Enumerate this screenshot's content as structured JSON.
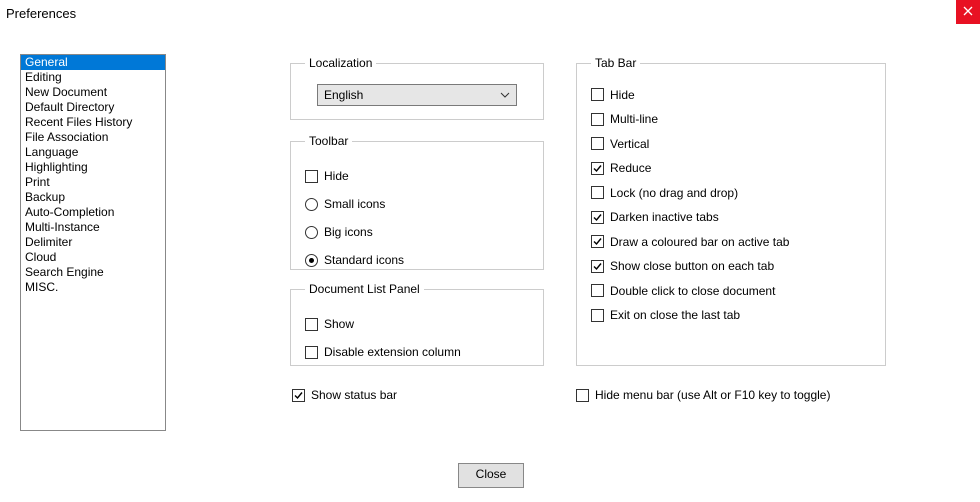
{
  "title": "Preferences",
  "categories": [
    "General",
    "Editing",
    "New Document",
    "Default Directory",
    "Recent Files History",
    "File Association",
    "Language",
    "Highlighting",
    "Print",
    "Backup",
    "Auto-Completion",
    "Multi-Instance",
    "Delimiter",
    "Cloud",
    "Search Engine",
    "MISC."
  ],
  "selected_category_index": 0,
  "localization": {
    "legend": "Localization",
    "value": "English"
  },
  "toolbar": {
    "legend": "Toolbar",
    "options": [
      {
        "type": "checkbox",
        "label": "Hide",
        "checked": false,
        "name": "toolbar-hide"
      },
      {
        "type": "radio",
        "label": "Small icons",
        "checked": false,
        "name": "toolbar-small-icons"
      },
      {
        "type": "radio",
        "label": "Big icons",
        "checked": false,
        "name": "toolbar-big-icons"
      },
      {
        "type": "radio",
        "label": "Standard icons",
        "checked": true,
        "name": "toolbar-standard-icons"
      }
    ]
  },
  "doc_list": {
    "legend": "Document List Panel",
    "options": [
      {
        "type": "checkbox",
        "label": "Show",
        "checked": false,
        "name": "doc-list-show"
      },
      {
        "type": "checkbox",
        "label": "Disable extension column",
        "checked": false,
        "name": "doc-list-disable-ext-col"
      }
    ]
  },
  "tab_bar": {
    "legend": "Tab Bar",
    "options": [
      {
        "type": "checkbox",
        "label": "Hide",
        "checked": false,
        "name": "tab-hide"
      },
      {
        "type": "checkbox",
        "label": "Multi-line",
        "checked": false,
        "name": "tab-multiline"
      },
      {
        "type": "checkbox",
        "label": "Vertical",
        "checked": false,
        "name": "tab-vertical"
      },
      {
        "type": "checkbox",
        "label": "Reduce",
        "checked": true,
        "name": "tab-reduce"
      },
      {
        "type": "checkbox",
        "label": "Lock (no drag and drop)",
        "checked": false,
        "name": "tab-lock"
      },
      {
        "type": "checkbox",
        "label": "Darken inactive tabs",
        "checked": true,
        "name": "tab-darken-inactive"
      },
      {
        "type": "checkbox",
        "label": "Draw a coloured bar on active tab",
        "checked": true,
        "name": "tab-coloured-bar"
      },
      {
        "type": "checkbox",
        "label": "Show close button on each tab",
        "checked": true,
        "name": "tab-show-close"
      },
      {
        "type": "checkbox",
        "label": "Double click to close document",
        "checked": false,
        "name": "tab-dblclick-close"
      },
      {
        "type": "checkbox",
        "label": "Exit on close the last tab",
        "checked": false,
        "name": "tab-exit-on-last"
      }
    ]
  },
  "free": {
    "show_status_bar": "Show status bar",
    "hide_menu_bar": "Hide menu bar (use Alt or F10 key to toggle)"
  },
  "buttons": {
    "close": "Close"
  }
}
